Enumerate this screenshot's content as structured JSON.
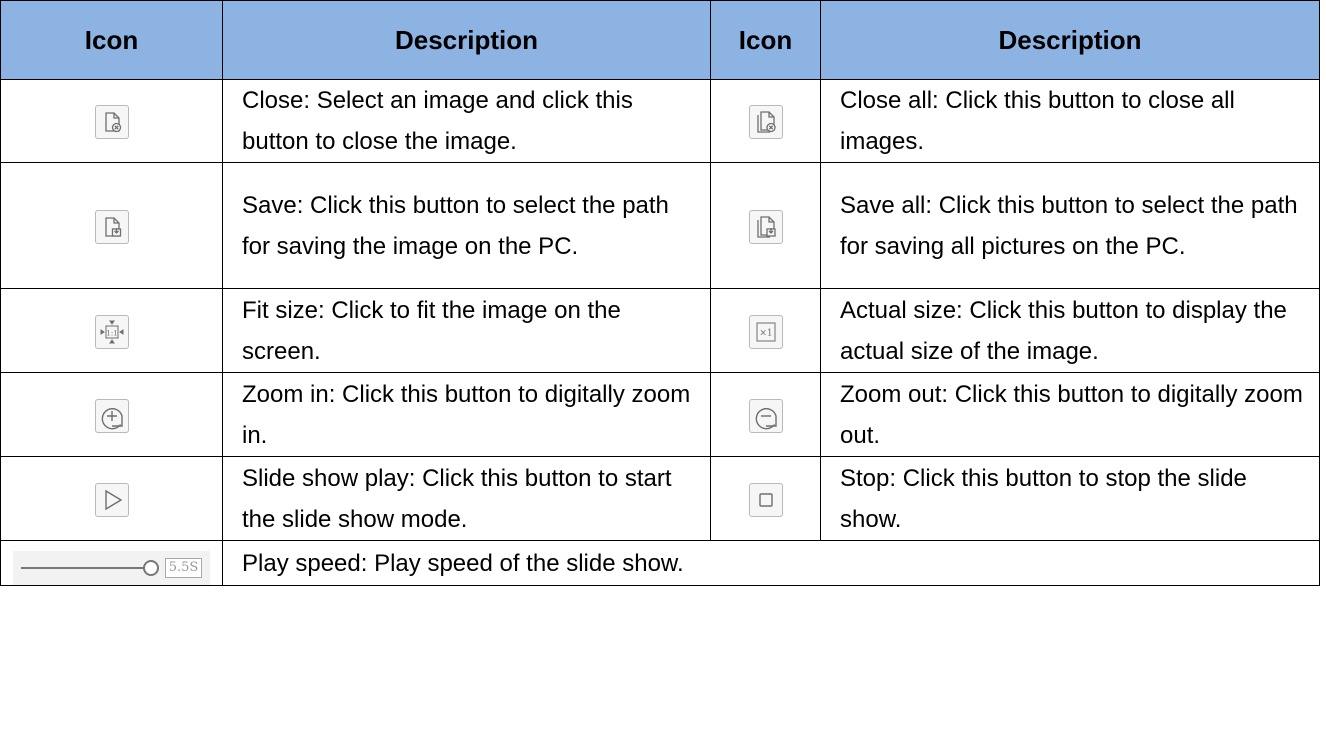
{
  "headers": {
    "icon1": "Icon",
    "description1": "Description",
    "icon2": "Icon",
    "description2": "Description"
  },
  "rows": [
    {
      "left_icon": "close-image-icon",
      "left_text": "Close: Select an image and click this button to close the image.",
      "right_icon": "close-all-images-icon",
      "right_text": "Close all: Click this button to close all images."
    },
    {
      "left_icon": "save-image-icon",
      "left_text": "Save: Click this button to select the path for saving the image on the PC.",
      "right_icon": "save-all-images-icon",
      "right_text": "Save all: Click this button to select the path for saving all pictures on the PC."
    },
    {
      "left_icon": "fit-size-icon",
      "left_text": "Fit size: Click to fit the image on the screen.",
      "right_icon": "actual-size-icon",
      "right_text": "Actual size: Click this button to display the actual size of the image."
    },
    {
      "left_icon": "zoom-in-icon",
      "left_text": "Zoom in: Click this button to digitally zoom in.",
      "right_icon": "zoom-out-icon",
      "right_text": "Zoom out: Click this button to digitally zoom out."
    },
    {
      "left_icon": "play-icon",
      "left_text": "Slide show play: Click this button to start the slide show mode.",
      "right_icon": "stop-icon",
      "right_text": "Stop: Click this button to stop the slide show."
    }
  ],
  "play_speed_row": {
    "icon": "play-speed-slider",
    "speed_value": "5.5S",
    "slider_level": 1.0,
    "text": "Play speed: Play speed of the slide show."
  },
  "icon_labels": {
    "fit_size": "1:1",
    "actual_size": "×1"
  },
  "colors": {
    "header_bg": "#8db3e2",
    "border": "#000000",
    "icon_stroke": "#6e6e6e"
  }
}
